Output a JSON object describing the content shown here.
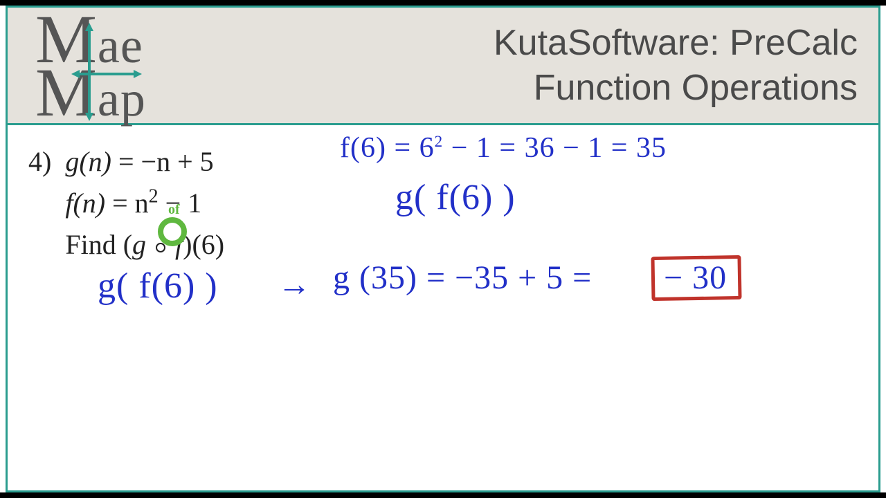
{
  "header": {
    "logo_line1_big": "M",
    "logo_line1_rest": "ae",
    "logo_line2_big": "M",
    "logo_line2_rest": "ap",
    "title_line1": "KutaSoftware: PreCalc",
    "title_line2": "Function Operations"
  },
  "problem": {
    "number": "4)",
    "g_def_lhs": "g",
    "g_def_arg": "n",
    "g_def_rhs": " = −n + 5",
    "f_def_lhs": "f",
    "f_def_arg": "n",
    "f_def_rhs_pre": " = n",
    "f_def_exp": "2",
    "f_def_rhs_post": " − 1",
    "find_label": "Find ",
    "compose_lhs": "g",
    "compose_rhs": "f",
    "compose_arg": "6",
    "of_annotation": "of"
  },
  "work": {
    "f6": "f(6) = 6",
    "f6_exp": "2",
    "f6_cont": "− 1 = 36 − 1 = 35",
    "gf6_top": "g( f(6) )",
    "gf6_left": "g( f(6) )",
    "g35": "g (35) = −35 + 5 =",
    "answer": "− 30"
  }
}
